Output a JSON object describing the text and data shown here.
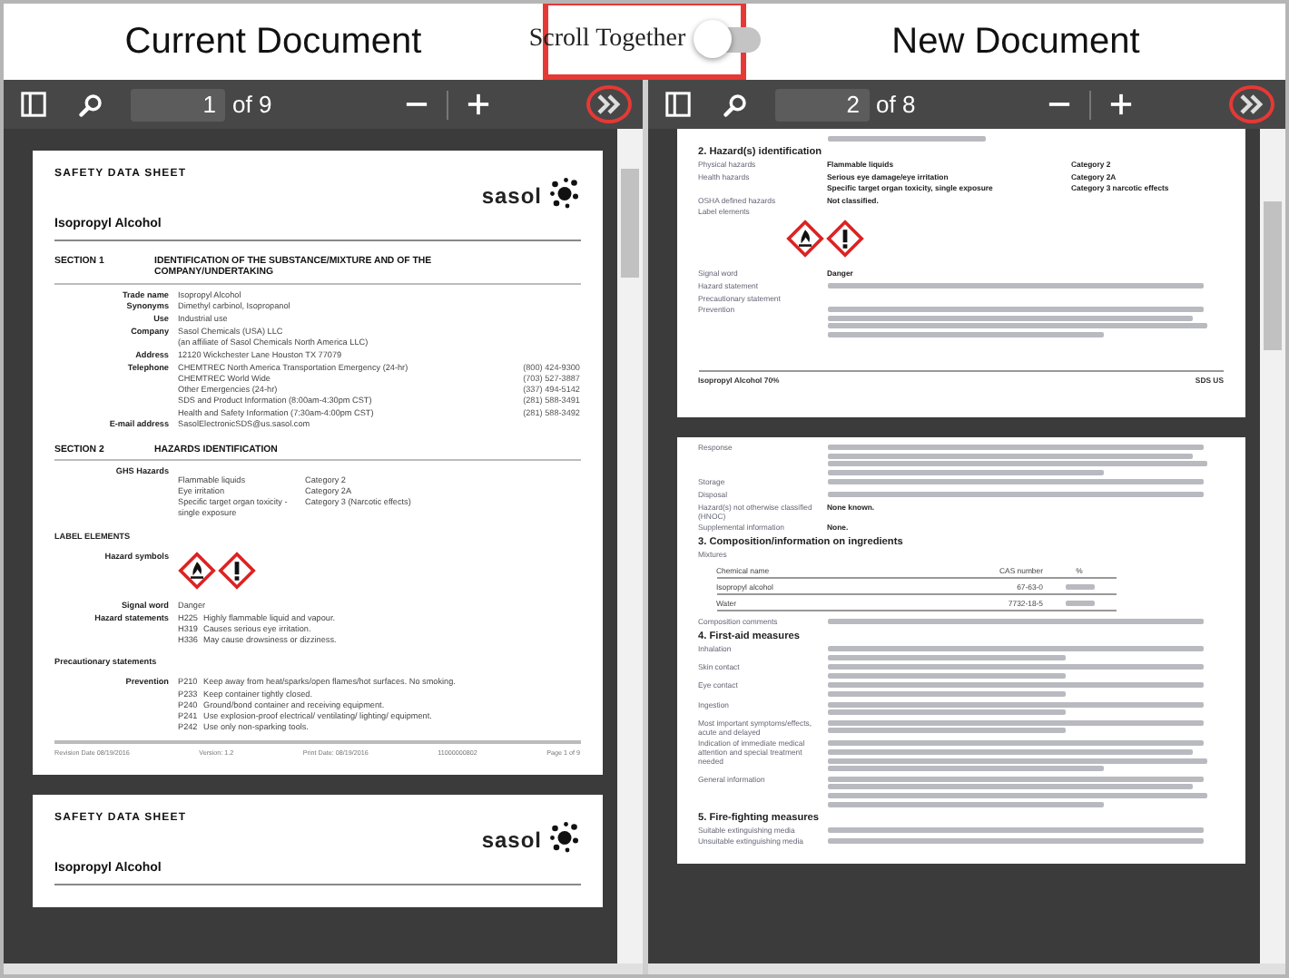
{
  "header": {
    "left_title": "Current Document",
    "right_title": "New Document",
    "toggle": {
      "label": "Scroll Together",
      "on": false
    }
  },
  "viewers": [
    {
      "page": "1",
      "page_count": "of 9",
      "pages": [
        {
          "blocks": [
            {
              "kind": "brand",
              "title": "SAFETY DATA SHEET",
              "logo": "sasol"
            },
            {
              "kind": "product",
              "text": "Isopropyl Alcohol"
            },
            {
              "kind": "section",
              "number": "SECTION 1",
              "title": "IDENTIFICATION OF THE SUBSTANCE/MIXTURE AND OF THE COMPANY/UNDERTAKING"
            },
            {
              "kind": "field",
              "label": "Trade name",
              "lines": [
                "Isopropyl Alcohol"
              ]
            },
            {
              "kind": "field",
              "label": "Synonyms",
              "lines": [
                "Dimethyl carbinol, Isopropanol"
              ]
            },
            {
              "kind": "field",
              "label": "Use",
              "lines": [
                "Industrial use"
              ]
            },
            {
              "kind": "field",
              "label": "Company",
              "lines": [
                "Sasol Chemicals (USA) LLC",
                "(an affiliate of Sasol Chemicals North America LLC)"
              ]
            },
            {
              "kind": "field",
              "label": "Address",
              "lines": [
                "12120 Wickchester Lane   Houston TX 77079"
              ]
            },
            {
              "kind": "field",
              "label": "Telephone",
              "lines": [
                "CHEMTREC North America Transportation Emergency (24-hr)",
                "CHEMTREC World Wide",
                "Other Emergencies (24-hr)",
                "SDS and Product Information (8:00am-4:30pm CST)",
                "Health and Safety Information (7:30am-4:00pm CST)"
              ],
              "phones": [
                "(800) 424-9300",
                "(703) 527-3887",
                "(337) 494-5142",
                "(281) 588-3491",
                "(281) 588-3492"
              ]
            },
            {
              "kind": "field",
              "label": "E-mail address",
              "lines": [
                "SasolElectronicSDS@us.sasol.com"
              ]
            },
            {
              "kind": "section",
              "number": "SECTION 2",
              "title": "HAZARDS IDENTIFICATION"
            },
            {
              "kind": "grid",
              "label": "GHS Hazards",
              "rows": [
                {
                  "a": "Flammable liquids",
                  "b": "Category 2"
                },
                {
                  "a": "Eye irritation",
                  "b": "Category 2A"
                },
                {
                  "a": "Specific target organ toxicity - single exposure",
                  "b": "Category 3 (Narcotic effects)"
                }
              ]
            },
            {
              "kind": "subhead",
              "text": "LABEL ELEMENTS"
            },
            {
              "kind": "pictograms",
              "label": "Hazard symbols"
            },
            {
              "kind": "field",
              "label": "Signal word",
              "lines": [
                "Danger"
              ]
            },
            {
              "kind": "codes",
              "label": "Hazard statements",
              "items": [
                {
                  "code": "H225",
                  "text": "Highly flammable liquid and vapour."
                },
                {
                  "code": "H319",
                  "text": "Causes serious eye irritation."
                },
                {
                  "code": "H336",
                  "text": "May cause drowsiness or dizziness."
                }
              ]
            },
            {
              "kind": "subhead",
              "text": "Precautionary statements"
            },
            {
              "kind": "codes",
              "label": "Prevention",
              "items": [
                {
                  "code": "P210",
                  "text": "Keep away from heat/sparks/open flames/hot surfaces. No smoking."
                },
                {
                  "code": "P233",
                  "text": "Keep container tightly closed."
                },
                {
                  "code": "P240",
                  "text": "Ground/bond container and receiving equipment."
                },
                {
                  "code": "P241",
                  "text": "Use explosion-proof electrical/ ventilating/ lighting/ equipment."
                },
                {
                  "code": "P242",
                  "text": "Use only non-sparking tools."
                }
              ]
            },
            {
              "kind": "footer",
              "cells": [
                "Revision Date 08/19/2016",
                "Version: 1.2",
                "Print Date: 08/19/2016",
                "11000000802",
                "Page 1 of 9"
              ]
            }
          ]
        },
        {
          "blocks": [
            {
              "kind": "brand",
              "title": "SAFETY DATA SHEET",
              "logo": "sasol"
            },
            {
              "kind": "product",
              "text": "Isopropyl Alcohol"
            }
          ]
        }
      ]
    },
    {
      "page": "2",
      "page_count": "of 8",
      "pages": [
        {
          "blocks": [
            {
              "kind": "row_short"
            },
            {
              "kind": "heading",
              "text": "2. Hazard(s) identification"
            },
            {
              "kind": "row",
              "label": "Physical hazards",
              "value": "Flammable liquids",
              "value2": "Category 2"
            },
            {
              "kind": "row",
              "label": "Health hazards",
              "value": "Serious eye damage/eye irritation",
              "value2": "Category 2A"
            },
            {
              "kind": "row",
              "value": "Specific target organ toxicity, single exposure",
              "value2": "Category 3 narcotic effects"
            },
            {
              "kind": "row",
              "label": "OSHA defined hazards",
              "value": "Not classified."
            },
            {
              "kind": "row",
              "label": "Label elements"
            },
            {
              "kind": "pictograms"
            },
            {
              "kind": "row",
              "label": "Signal word",
              "value": "Danger"
            },
            {
              "kind": "row_line",
              "label": "Hazard statement"
            },
            {
              "kind": "row",
              "label": "Precautionary statement"
            },
            {
              "kind": "row_para",
              "label": "Prevention"
            },
            {
              "kind": "rfooter",
              "left": "Isopropyl Alcohol 70%",
              "right": "SDS US"
            }
          ]
        },
        {
          "blocks": [
            {
              "kind": "row_para",
              "label": "Response"
            },
            {
              "kind": "row_line",
              "label": "Storage"
            },
            {
              "kind": "row_line",
              "label": "Disposal"
            },
            {
              "kind": "row",
              "label": "Hazard(s) not otherwise classified (HNOC)",
              "value": "None known."
            },
            {
              "kind": "row",
              "label": "Supplemental information",
              "value": "None."
            },
            {
              "kind": "heading",
              "text": "3. Composition/information on ingredients"
            },
            {
              "kind": "row",
              "label": "Mixtures"
            },
            {
              "kind": "table",
              "columns": [
                "Chemical name",
                "CAS number",
                "%"
              ],
              "rows": [
                {
                  "name": "Isopropyl alcohol",
                  "cas": "67-63-0"
                },
                {
                  "name": "Water",
                  "cas": "7732-18-5"
                }
              ]
            },
            {
              "kind": "row_line",
              "label": "Composition comments"
            },
            {
              "kind": "heading",
              "text": "4. First-aid measures"
            },
            {
              "kind": "row_two",
              "label": "Inhalation"
            },
            {
              "kind": "row_two",
              "label": "Skin contact"
            },
            {
              "kind": "row_two",
              "label": "Eye contact"
            },
            {
              "kind": "row_two",
              "label": "Ingestion"
            },
            {
              "kind": "row_two",
              "label": "Most important symptoms/effects, acute and delayed"
            },
            {
              "kind": "row_para",
              "label": "Indication of immediate medical attention and special treatment needed"
            },
            {
              "kind": "row_para",
              "label": "General information"
            },
            {
              "kind": "heading",
              "text": "5. Fire-fighting measures"
            },
            {
              "kind": "row_line",
              "label": "Suitable extinguishing media"
            },
            {
              "kind": "row_line",
              "label": "Unsuitable extinguishing media"
            }
          ]
        }
      ]
    }
  ]
}
